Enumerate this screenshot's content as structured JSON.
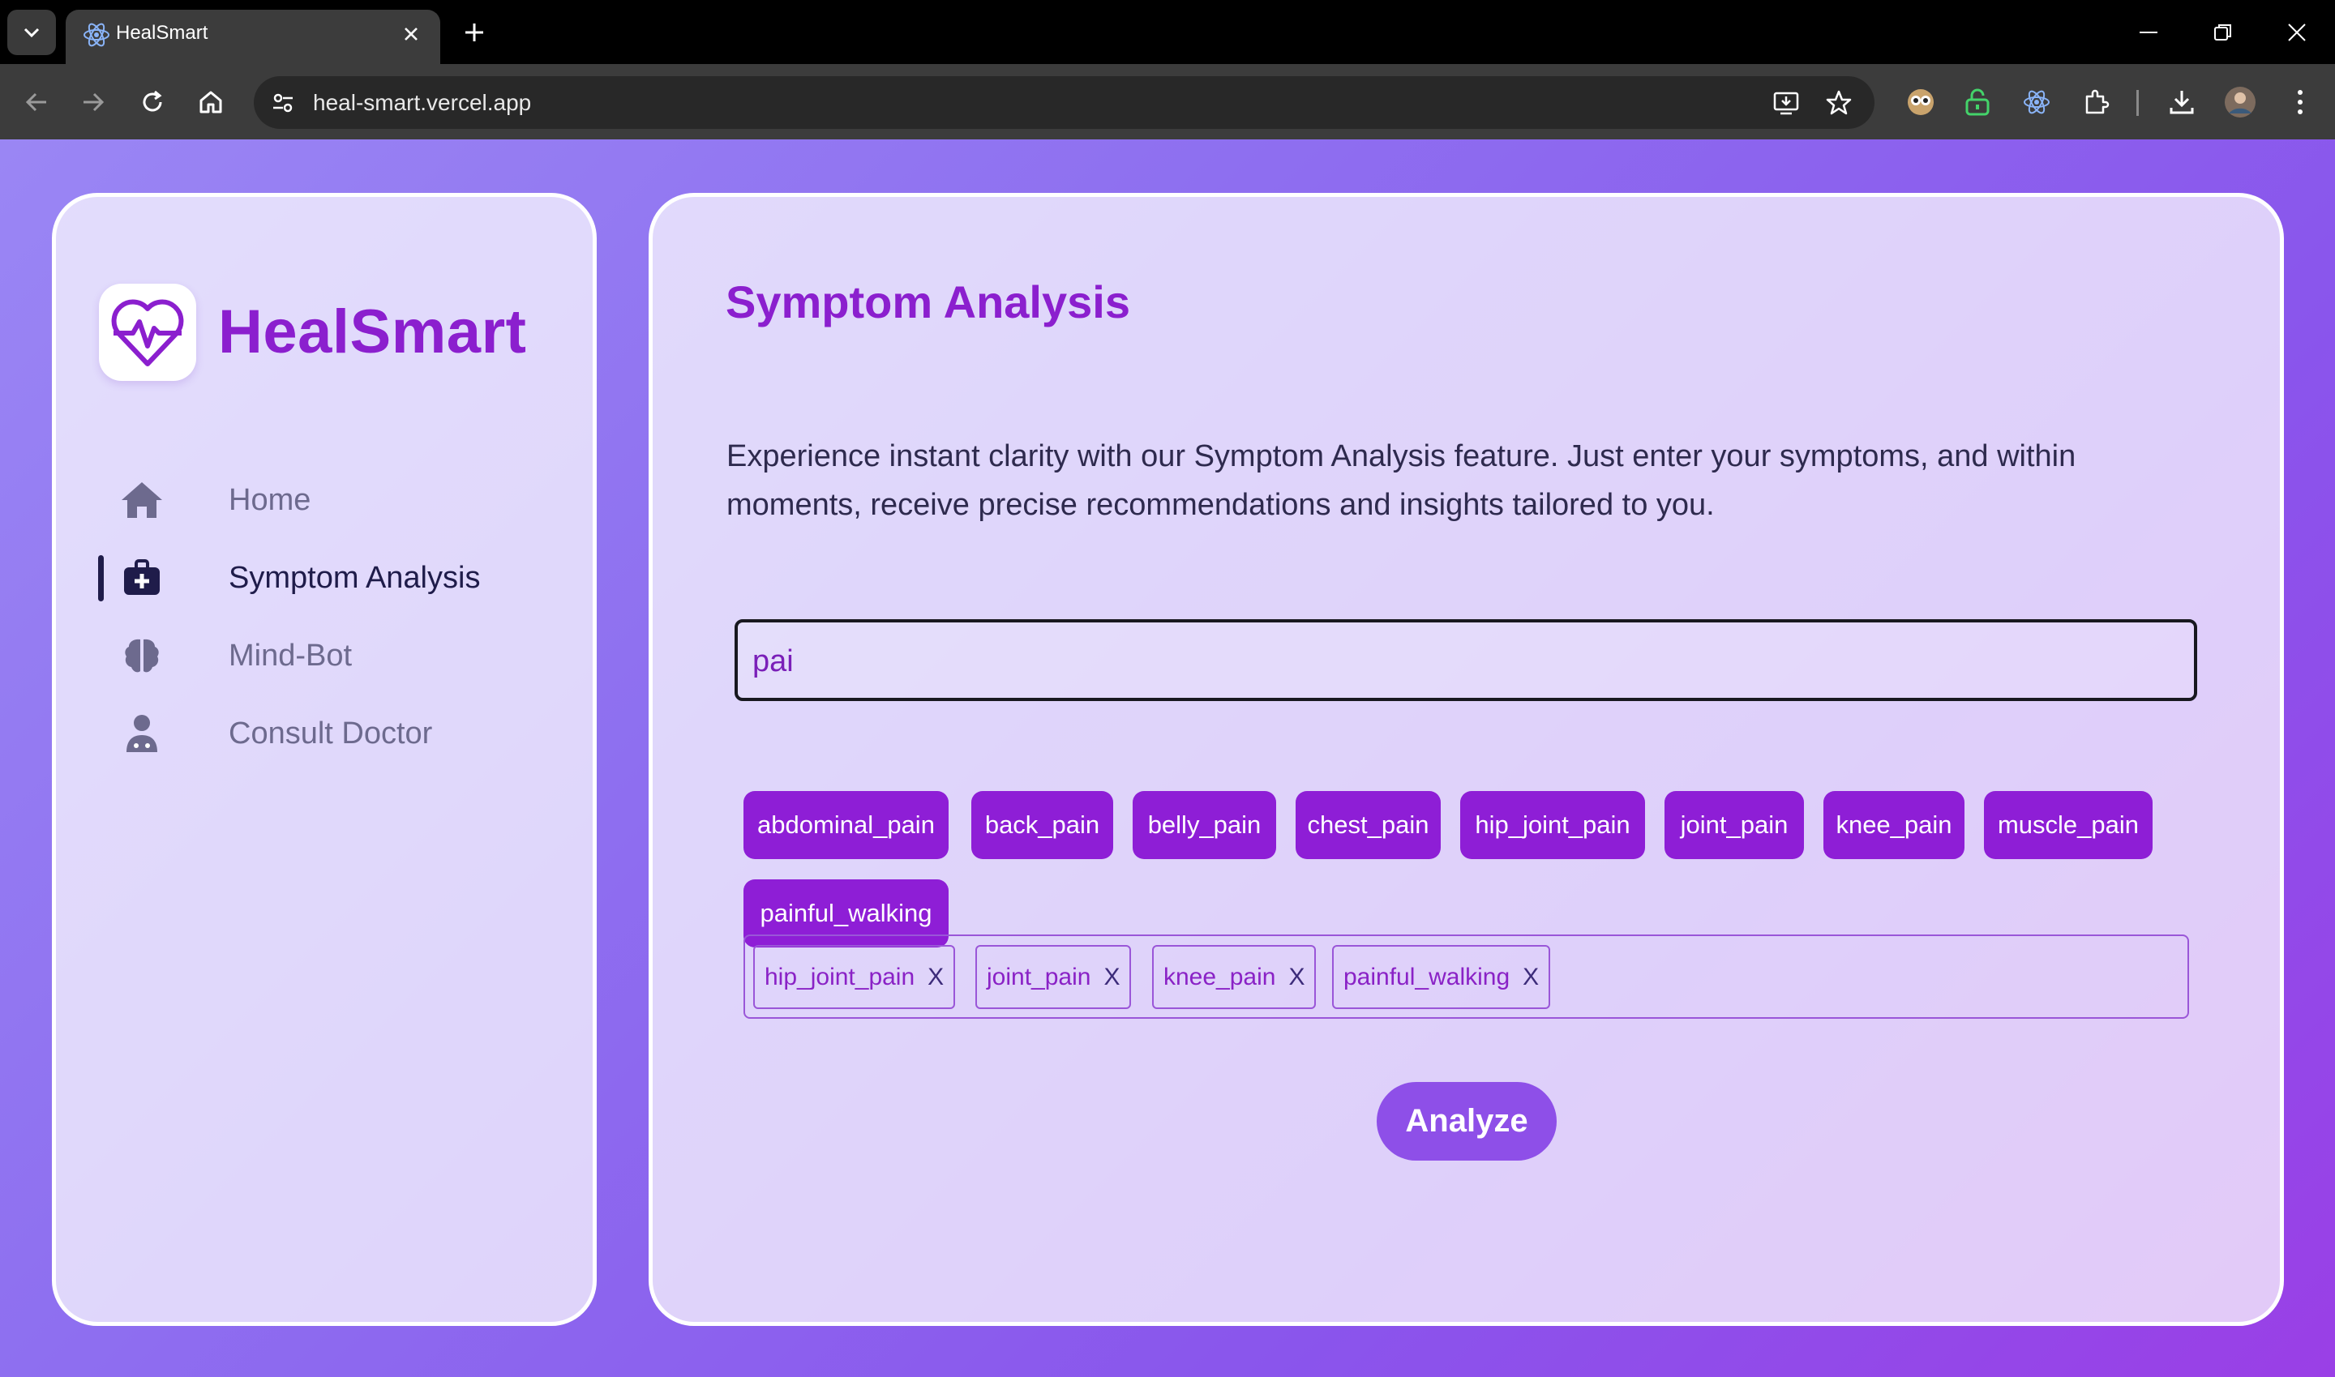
{
  "browser": {
    "tab_title": "HealSmart",
    "url": "heal-smart.vercel.app"
  },
  "sidebar": {
    "brand": "HealSmart",
    "items": [
      {
        "label": "Home",
        "icon": "home-icon",
        "active": false
      },
      {
        "label": "Symptom Analysis",
        "icon": "medical-kit-icon",
        "active": true
      },
      {
        "label": "Mind-Bot",
        "icon": "brain-icon",
        "active": false
      },
      {
        "label": "Consult Doctor",
        "icon": "doctor-icon",
        "active": false
      }
    ]
  },
  "main": {
    "title": "Symptom Analysis",
    "description": "Experience instant clarity with our Symptom Analysis feature. Just enter your symptoms, and within moments, receive precise recommendations and insights tailored to you.",
    "search": {
      "value": "pai",
      "placeholder": ""
    },
    "suggestions": [
      "abdominal_pain",
      "back_pain",
      "belly_pain",
      "chest_pain",
      "hip_joint_pain",
      "joint_pain",
      "knee_pain",
      "muscle_pain",
      "painful_walking"
    ],
    "selected": [
      {
        "label": "hip_joint_pain",
        "remove": "X"
      },
      {
        "label": "joint_pain",
        "remove": "X"
      },
      {
        "label": "knee_pain",
        "remove": "X"
      },
      {
        "label": "painful_walking",
        "remove": "X"
      }
    ],
    "analyze_label": "Analyze"
  },
  "colors": {
    "accent": "#8b1fce",
    "chip": "#8e1ed6",
    "button": "#8e4fe8",
    "nav_active": "#1f1c4a",
    "nav_inactive": "#6d6a8e"
  }
}
